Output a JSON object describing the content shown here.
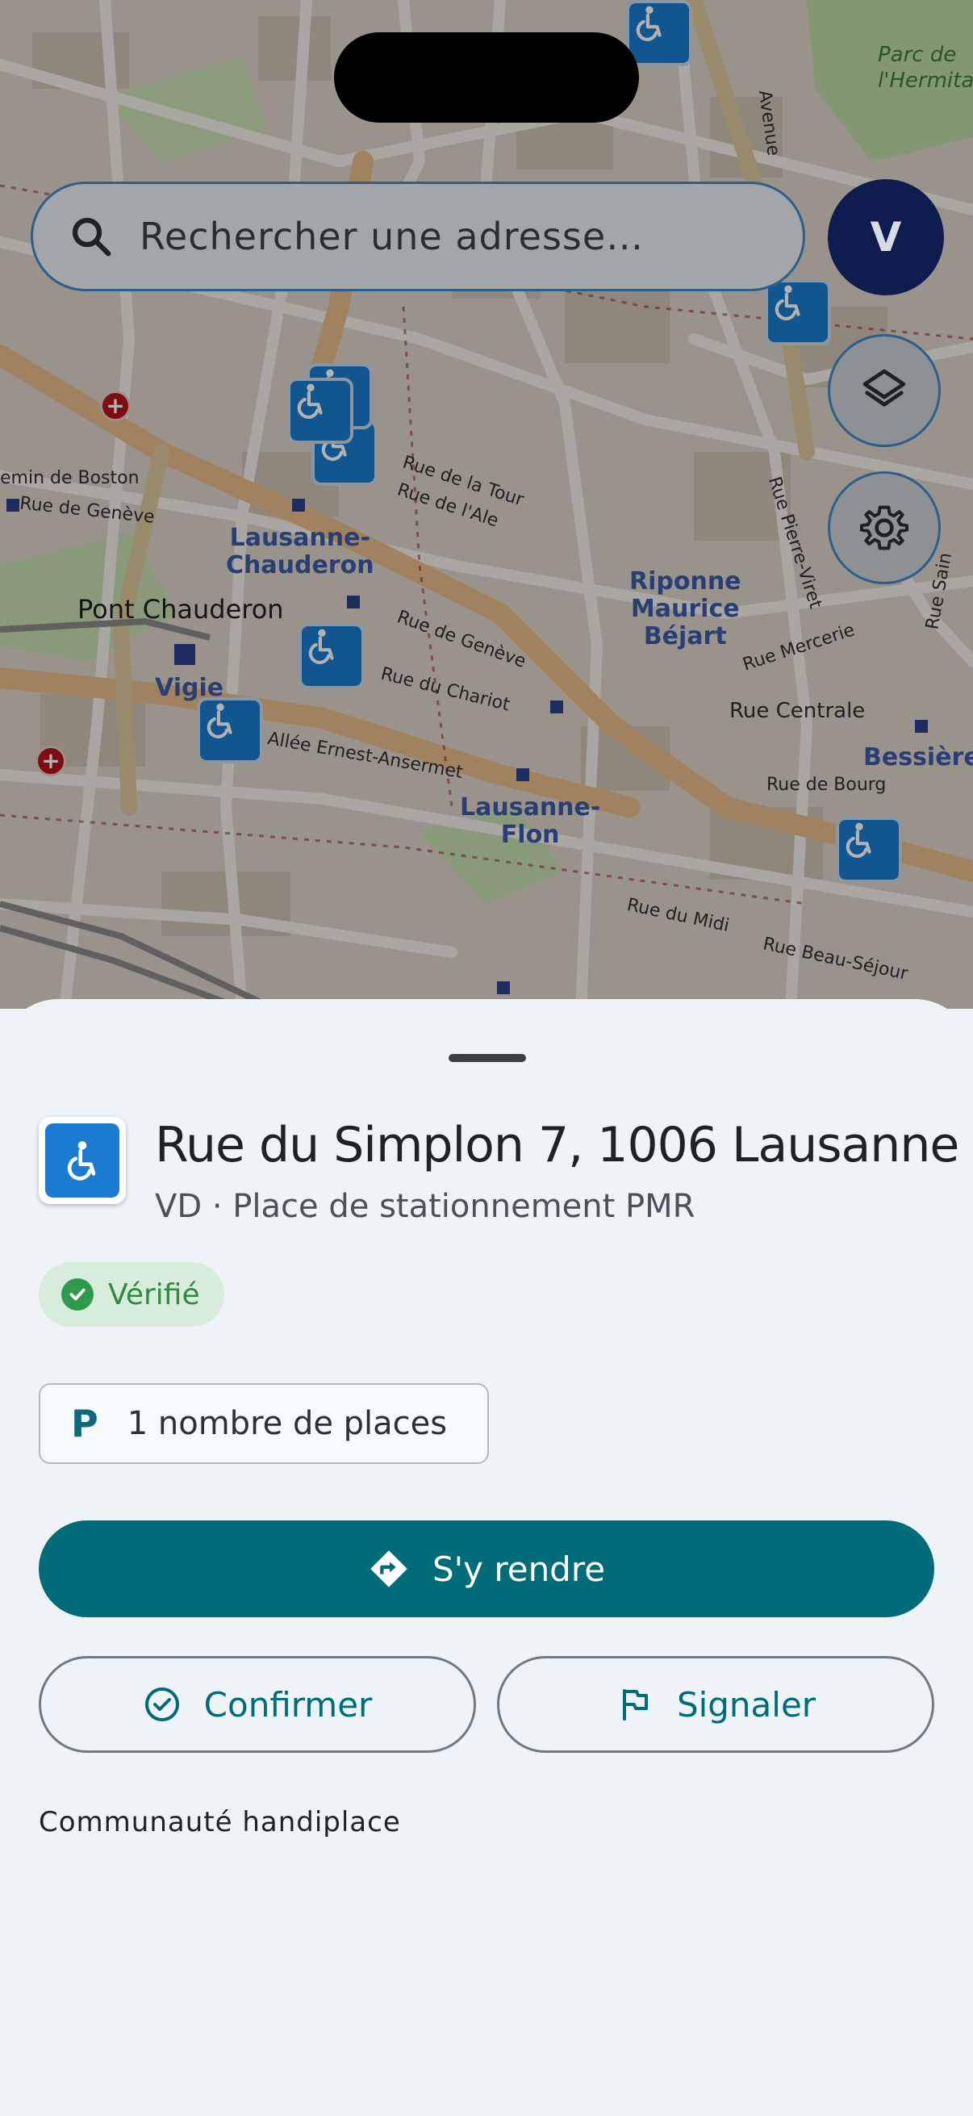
{
  "search": {
    "placeholder": "Rechercher une adresse…"
  },
  "user": {
    "avatar_initial": "V"
  },
  "map": {
    "labels": {
      "parc": "Parc de\nl'Hermitage",
      "avenue": "Avenue",
      "rue_de_la_tour": "Rue de la Tour",
      "rue_de_l_ale": "Rue de l'Ale",
      "chemin_de_boston": "emin de Boston",
      "rue_de_geneve_left": "Rue de Genève",
      "chauderon": "Lausanne-\nChauderon",
      "pont_chauderon": "Pont Chauderon",
      "rue_de_geneve_mid": "Rue de Genève",
      "riponne": "Riponne\nMaurice\nBéjart",
      "rue_pierre_viret": "Rue Pierre-Viret",
      "rue_mercerie": "Rue Mercerie",
      "rue_saint": "Rue Sain",
      "vigie": "Vigie",
      "rue_du_chariot": "Rue du Chariot",
      "rue_centrale": "Rue Centrale",
      "bessieres": "Bessières",
      "allee_ernest": "Allée Ernest-Ansermet",
      "flon": "Lausanne-\nFlon",
      "rue_de_bourg": "Rue de Bourg",
      "rue_du_midi": "Rue du Midi",
      "rue_beau_sejour": "Rue Beau-Séjour"
    }
  },
  "detail": {
    "title": "Rue du Simplon 7, 1006 Lausanne",
    "subtitle": "VD · Place de stationnement PMR",
    "status_badge": "Vérifié",
    "places_letter": "P",
    "places_label": "1 nombre de places",
    "directions_label": "S'y rendre",
    "confirm_label": "Confirmer",
    "report_label": "Signaler",
    "source_label": "Communauté handiplace"
  },
  "colors": {
    "primary": "#006b79",
    "pmr_blue": "#1b7bd0",
    "verified_green": "#2e9a4a",
    "avatar_navy": "#0f1d4e"
  }
}
